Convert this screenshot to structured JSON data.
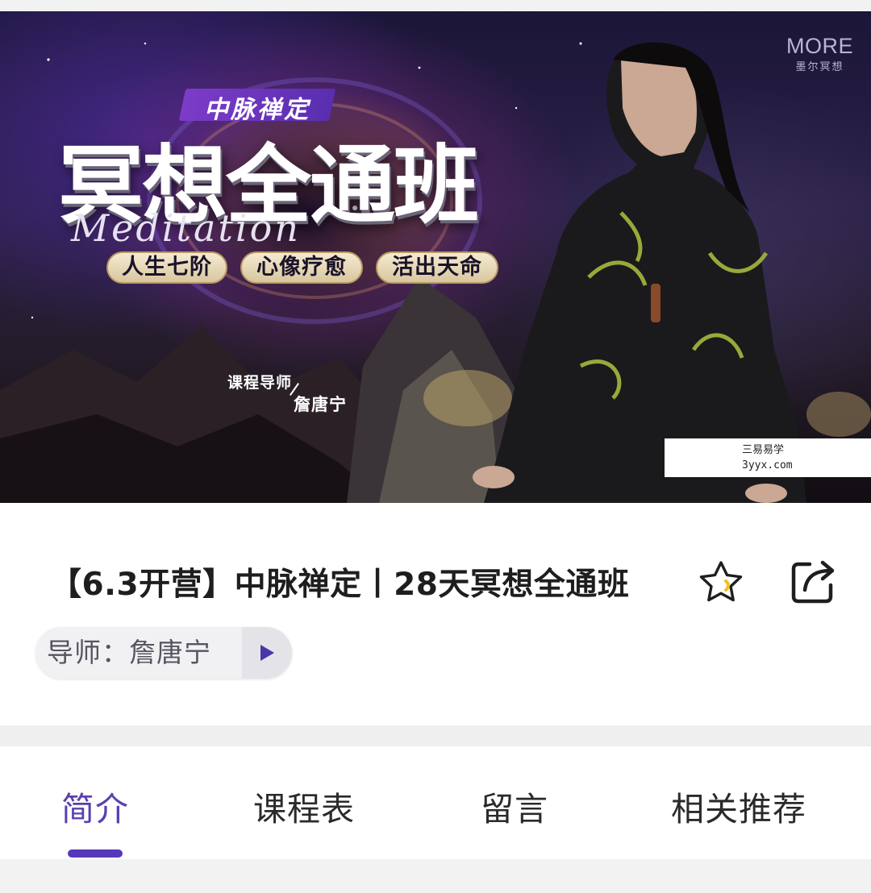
{
  "banner": {
    "logo_en": "MORE",
    "logo_cn": "墨尔冥想",
    "subtitle": "中脉禅定",
    "title": "冥想全通班",
    "script_word": "Meditation",
    "pills": [
      "人生七阶",
      "心像疗愈",
      "活出天命"
    ],
    "teacher_label": "课程导师",
    "teacher_name": "詹唐宁",
    "watermark_line1": "三易易学",
    "watermark_line2": "3yyx.com"
  },
  "course": {
    "title": "【6.3开营】中脉禅定丨28天冥想全通班",
    "favorite_icon": "star-icon",
    "share_icon": "share-icon",
    "mentor_label": "导师：",
    "mentor_name": "詹唐宁",
    "mentor_play_icon": "play-icon"
  },
  "tabs": {
    "items": [
      "简介",
      "课程表",
      "留言",
      "相关推荐"
    ],
    "active_index": 0
  },
  "colors": {
    "accent": "#5438b8",
    "active_tab": "#5a3fb0",
    "pill_gold": "#d8c69e",
    "subtitle_purple": "#7c3cc8"
  }
}
